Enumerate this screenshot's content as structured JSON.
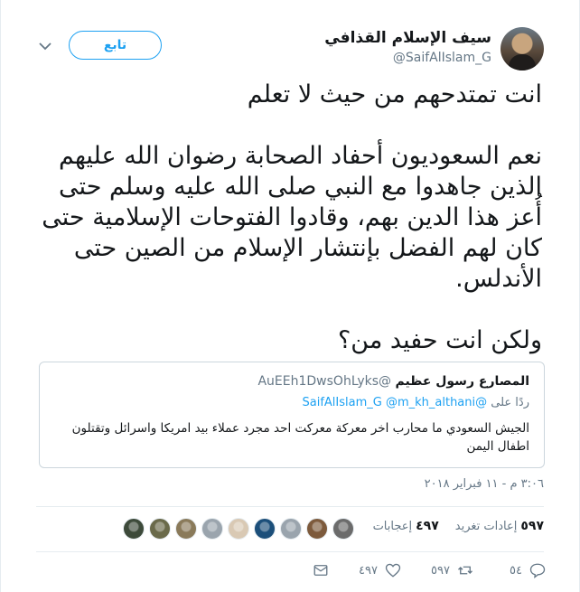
{
  "author": {
    "display_name": "سيف الإسلام القذافي",
    "handle": "@SaifAlIslam_G"
  },
  "header": {
    "follow_label": "تابع",
    "menu_icon": "chevron-down-icon"
  },
  "tweet": {
    "lines": [
      "انت تمتدحهم من حيث لا تعلم",
      "",
      "نعم السعوديون أحفاد الصحابة رضوان الله عليهم الذين جاهدوا مع النبي صلى الله عليه وسلم حتى أُعز هذا الدين بهم، وقادوا الفتوحات الإسلامية حتى كان لهم الفضل بإنتشار الإسلام من الصين حتى الأندلس.",
      "",
      "ولكن انت حفيد من؟"
    ]
  },
  "quote": {
    "name": "المصارع رسول عظيم",
    "handle": "@AuEEh1DwsOhLyks",
    "reply_prefix": "ردًا على",
    "reply_mentions": "@SaifAlIslam_G @m_kh_althani",
    "text": "الجيش السعودي ما محارب اخر معركة معركت احد مجرد عملاء بيد امريكا واسرائل وتقتلون اطفال اليمن"
  },
  "meta": {
    "timestamp": "٣:٠٦ م - ١١ فبراير ٢٠١٨"
  },
  "stats": {
    "retweets_count": "٥٩٧",
    "retweets_label": "إعادات تغريد",
    "likes_count": "٤٩٧",
    "likes_label": "إعجابات",
    "liker_colors": [
      "#6b6b6b",
      "#7d5a3c",
      "#9aa4ad",
      "#1c4f7a",
      "#d9c9b4",
      "#9aa4ad",
      "#8a7a5a",
      "#6a6a4a",
      "#3d4a3a"
    ]
  },
  "actions": {
    "reply_count": "٥٤",
    "retweet_count": "٥٩٧",
    "like_count": "٤٩٧"
  },
  "colors": {
    "accent": "#1da1f2",
    "muted": "#657786",
    "border": "#ccd6dd"
  }
}
